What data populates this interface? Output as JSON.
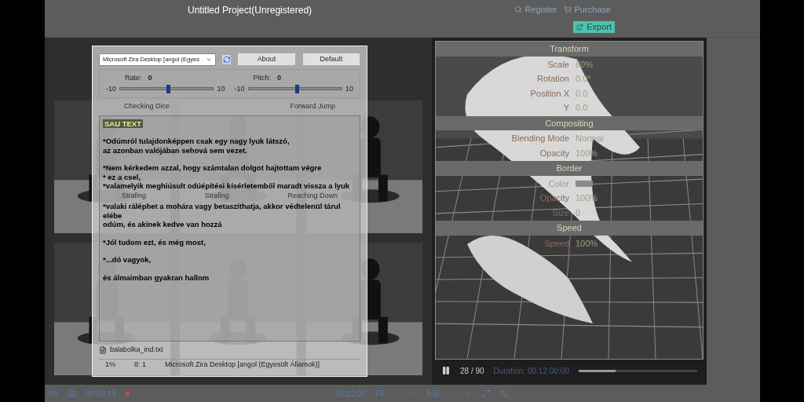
{
  "window": {
    "title": "Untitled Project(Unregistered)"
  },
  "header_links": [
    "Register",
    "Purchase"
  ],
  "export_button": "Export",
  "library": {
    "items": [
      {
        "label": "Strafing"
      },
      {
        "label": "Strafing"
      },
      {
        "label": "Reaching Down"
      }
    ],
    "category_labels": [
      "Checking Dice",
      "Forward Jump"
    ]
  },
  "preview": {
    "properties": [
      {
        "kind": "heading",
        "label": "Transform"
      },
      {
        "kind": "row",
        "label": "Scale",
        "value": "80%"
      },
      {
        "kind": "row",
        "label": "Rotation",
        "value": "0.0°"
      },
      {
        "kind": "row",
        "label": "Position X",
        "value": "0.0"
      },
      {
        "kind": "row",
        "label": "Y",
        "value": "0.0"
      },
      {
        "kind": "heading",
        "label": "Compositing"
      },
      {
        "kind": "row",
        "label": "Blending Mode",
        "value": "Normal"
      },
      {
        "kind": "row",
        "label": "Opacity",
        "value": "100%"
      },
      {
        "kind": "heading",
        "label": "Border"
      },
      {
        "kind": "color",
        "label": "Color",
        "color": "#8a8a8a"
      },
      {
        "kind": "row",
        "label": "Opacity",
        "value": "100%"
      },
      {
        "kind": "row",
        "label": "Size",
        "value": "0"
      },
      {
        "kind": "heading",
        "label": "Speed"
      },
      {
        "kind": "row",
        "label": "Speed",
        "value": "100%"
      }
    ],
    "frame": "28 / 90",
    "duration": "Duration: 00:12:00:00",
    "progress": {
      "level": 0.31
    }
  },
  "toolbar": {
    "time": "00:00:13",
    "total": "00:12:02",
    "fit": "Fit",
    "quality": "Full"
  },
  "dialog": {
    "voice": "Microsoft Zira Desktop [angol (Egyes",
    "buttons": [
      "About",
      "Default"
    ],
    "sliders": [
      {
        "label": "Rate:",
        "value": "0",
        "min": "-10",
        "max": "10",
        "level": 0.5
      },
      {
        "label": "Pitch:",
        "value": "0",
        "min": "-10",
        "max": "10",
        "level": 0.5
      }
    ],
    "paragraphs": [
      [
        "SAU TEXT"
      ],
      [
        "*Odúmról tulajdonképpen csak egy nagy lyuk látszó,",
        "az azonban valójában sehová sem vezet."
      ],
      [
        "*Nem kérkedem azzal, hogy számtalan dolgot hajtottam végre",
        "* ez a csel,",
        "*valamelyik meghiúsult odúépítési kísérletemből maradt vissza a lyuk"
      ],
      [
        "*valaki ráléphet a mohára vagy betaszíthatja, akkor védtelenül tárul elébe",
        "odúm, és akinek kedve van hozzá"
      ],
      [
        "*Jól tudom ezt, és még most,"
      ],
      [
        "*...dó vagyok,"
      ],
      [
        "és álmaimban gyakran hallom"
      ]
    ],
    "file": "balabolka_ind.txt",
    "status": [
      "1%",
      "8: 1",
      "Microsoft Zira Desktop [angol (Egyesült Államok)]"
    ]
  }
}
